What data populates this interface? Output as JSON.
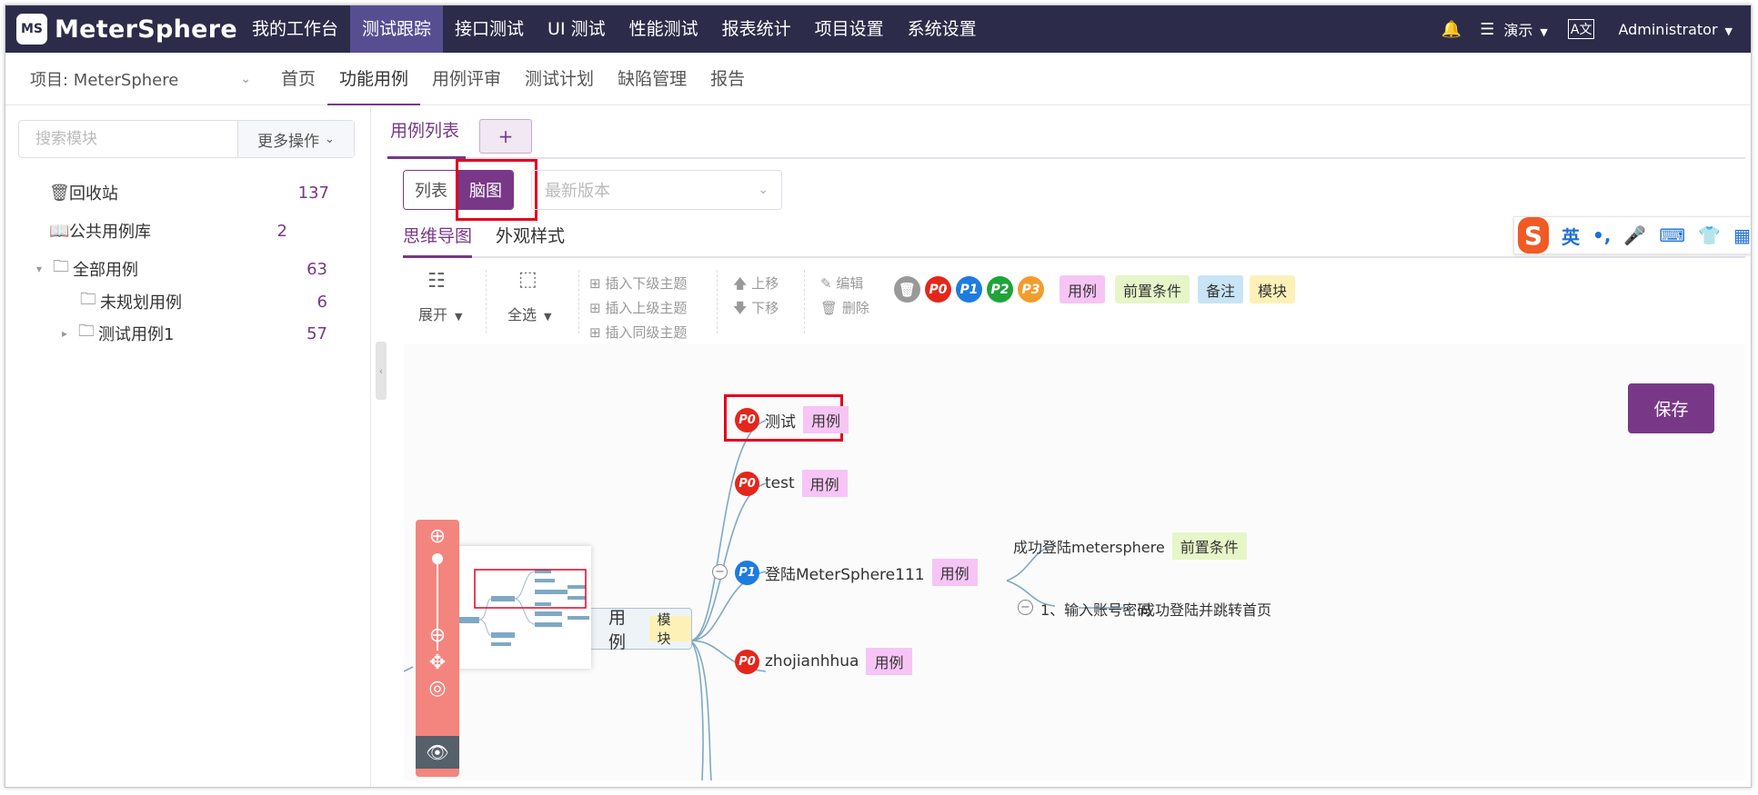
{
  "app": {
    "logo_text": "MeterSphere",
    "logo_mark": "MS"
  },
  "topnav": {
    "items": [
      "我的工作台",
      "测试跟踪",
      "接口测试",
      "UI 测试",
      "性能测试",
      "报表统计",
      "项目设置",
      "系统设置"
    ],
    "active": "测试跟踪",
    "workspace": "演示",
    "user": "Administrator"
  },
  "subnav": {
    "project_label": "项目: MeterSphere",
    "items": [
      "首页",
      "功能用例",
      "用例评审",
      "测试计划",
      "缺陷管理",
      "报告"
    ],
    "active": "功能用例"
  },
  "sidebar": {
    "search_placeholder": "搜索模块",
    "more_ops": "更多操作",
    "tree": [
      {
        "label": "回收站",
        "count": "137"
      },
      {
        "label": "公共用例库",
        "count": "2"
      },
      {
        "label": "全部用例",
        "count": "63"
      },
      {
        "label": "未规划用例",
        "count": "6"
      },
      {
        "label": "测试用例1",
        "count": "57"
      }
    ]
  },
  "main": {
    "tab_label": "用例列表",
    "add_tab": "+",
    "view_list": "列表",
    "view_mind": "脑图",
    "version_placeholder": "最新版本",
    "mind_tabs": [
      "思维导图",
      "外观样式"
    ],
    "toolbar": {
      "expand": "展开",
      "select_all": "全选",
      "insert_child": "插入下级主题",
      "insert_parent": "插入上级主题",
      "insert_sibling": "插入同级主题",
      "move_up": "上移",
      "move_down": "下移",
      "edit": "编辑",
      "delete": "删除",
      "priorities": [
        "P0",
        "P1",
        "P2",
        "P3"
      ],
      "tags": [
        "用例",
        "前置条件",
        "备注",
        "模块"
      ]
    },
    "save_label": "保存"
  },
  "mindmap": {
    "root": {
      "label": "用例",
      "tag": "模块"
    },
    "nodes": [
      {
        "priority": "P0",
        "label": "测试",
        "tag": "用例"
      },
      {
        "priority": "P0",
        "label": "test",
        "tag": "用例"
      },
      {
        "priority": "P1",
        "label": "登陆MeterSphere111",
        "tag": "用例"
      },
      {
        "priority": "P0",
        "label": "zhojianhhua",
        "tag": "用例"
      }
    ],
    "precondition": {
      "label": "成功登陆metersphere",
      "tag": "前置条件"
    },
    "step": {
      "label": "1、输入账号密码",
      "result": "成功登陆并跳转首页"
    }
  },
  "ime": {
    "mode": "英"
  },
  "colors": {
    "primary": "#783887",
    "topnav_bg": "#2c2c4a",
    "topnav_active": "#574e91",
    "p0": "#e4261b",
    "p1": "#1e7be0",
    "p2": "#1fa33a",
    "p3": "#f39c2b",
    "tag_case": "#f7c5f5",
    "tag_precond": "#e6f6c8",
    "tag_note": "#c8e4f6",
    "tag_module": "#fdf1b8",
    "highlight_box": "#e4001f"
  }
}
